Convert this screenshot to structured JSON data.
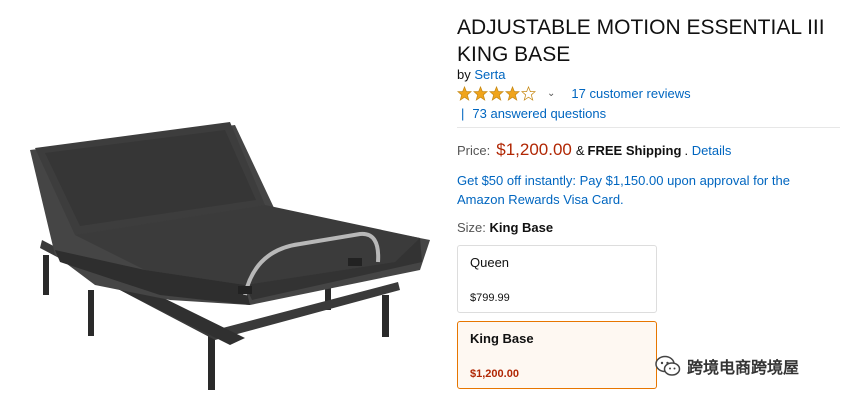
{
  "product": {
    "title": "ADJUSTABLE MOTION ESSENTIAL III KING BASE",
    "by_prefix": "by",
    "brand": "Serta",
    "rating_stars": 4,
    "reviews_link": "17 customer reviews",
    "qa_link": "73 answered questions"
  },
  "pricing": {
    "price_label": "Price:",
    "price": "$1,200.00",
    "ship_amp": "&",
    "free_shipping": "FREE Shipping",
    "ship_suffix": ".",
    "details_link": "Details",
    "promo_text": "Get $50 off instantly: Pay $1,150.00 upon approval for the Amazon Rewards Visa Card."
  },
  "size": {
    "label": "Size:",
    "selected": "King Base",
    "options": [
      {
        "name": "Queen",
        "price": "$799.99"
      },
      {
        "name": "King Base",
        "price": "$1,200.00"
      }
    ]
  },
  "watermark": {
    "text": "跨境电商跨境屋"
  },
  "colors": {
    "link": "#0066c0",
    "price": "#b12704",
    "star": "#f0a41b",
    "selected_border": "#e77600"
  }
}
